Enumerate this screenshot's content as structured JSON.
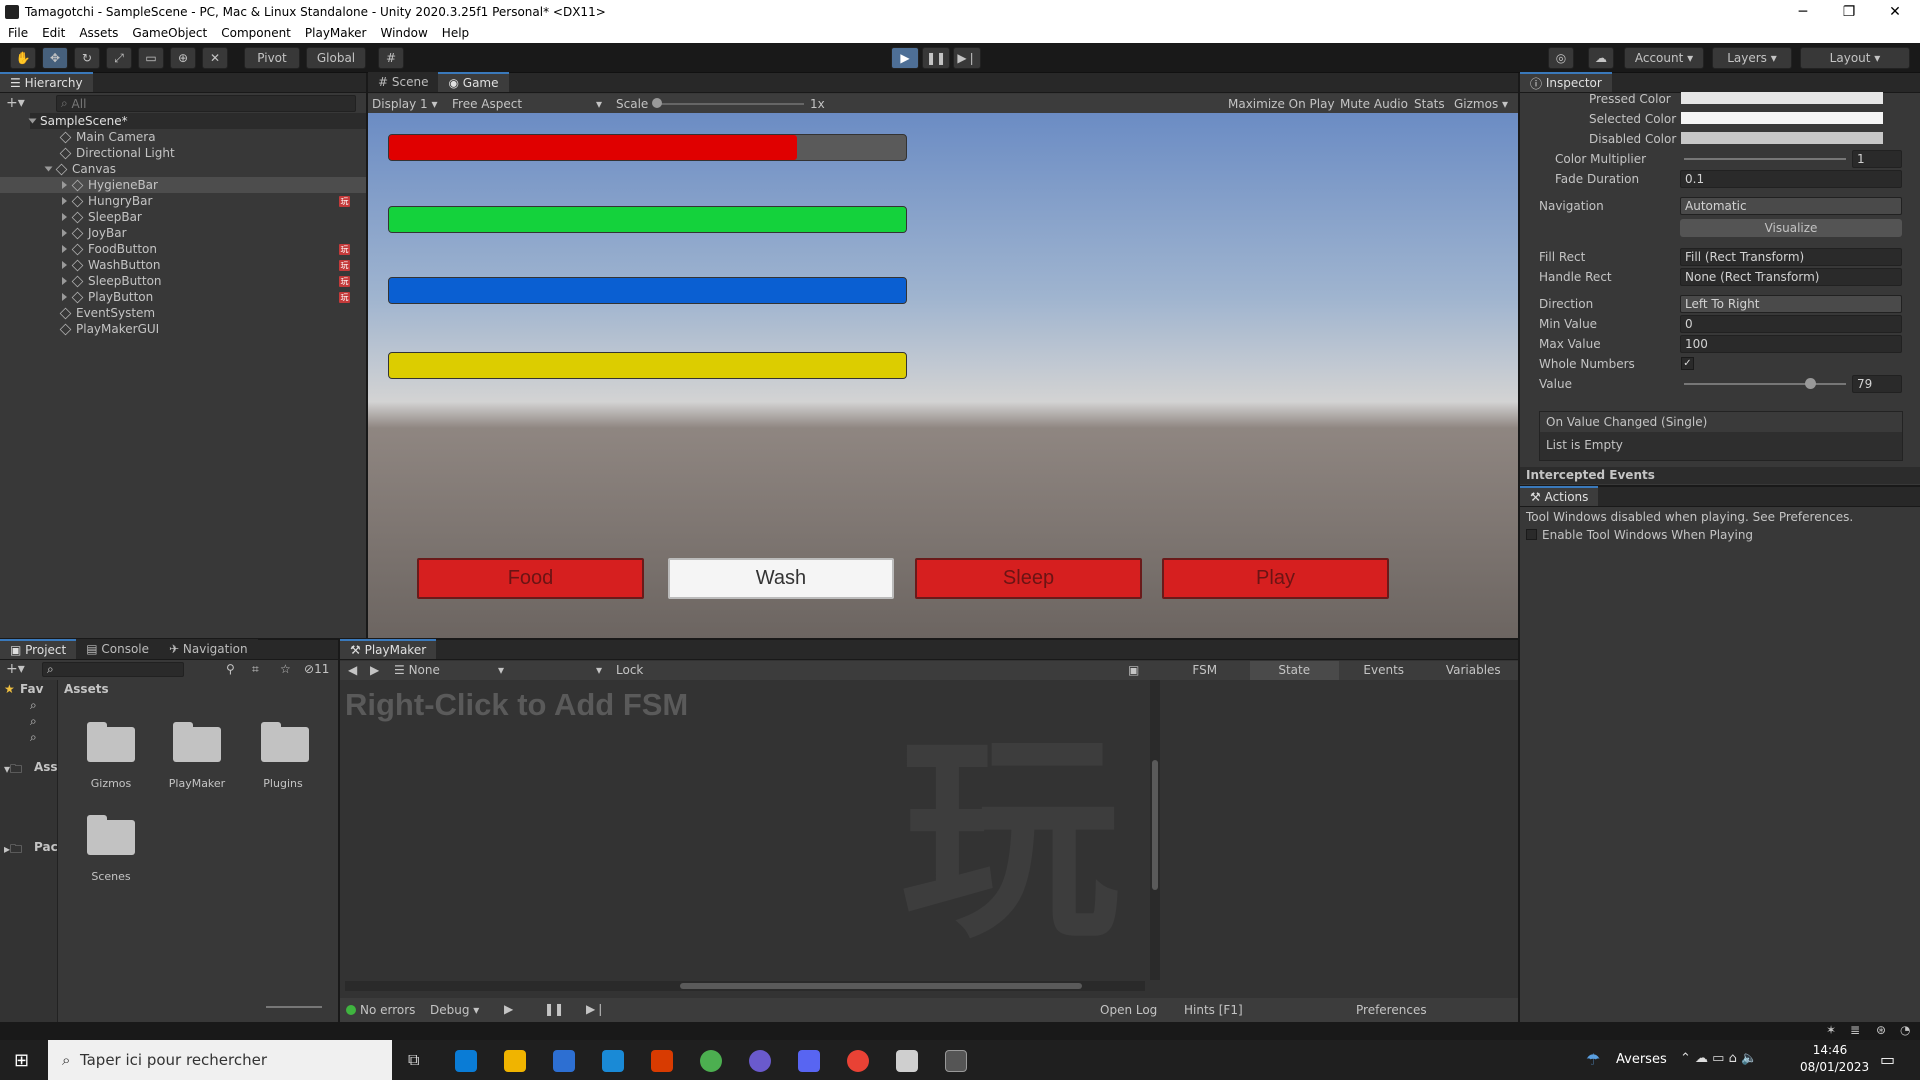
{
  "window": {
    "title": "Tamagotchi - SampleScene - PC, Mac & Linux Standalone - Unity 2020.3.25f1 Personal* <DX11>",
    "minimize": "─",
    "restore": "❐",
    "close": "✕"
  },
  "menu": [
    "File",
    "Edit",
    "Assets",
    "GameObject",
    "Component",
    "PlayMaker",
    "Window",
    "Help"
  ],
  "toolbar": {
    "pivot": "Pivot",
    "global": "Global",
    "account": "Account",
    "layers": "Layers",
    "layout": "Layout"
  },
  "hierarchy": {
    "tab": "Hierarchy",
    "search_placeholder": "All",
    "scene": "SampleScene*",
    "items": [
      {
        "name": "Main Camera"
      },
      {
        "name": "Directional Light"
      },
      {
        "name": "Canvas"
      },
      {
        "name": "HygieneBar"
      },
      {
        "name": "HungryBar"
      },
      {
        "name": "SleepBar"
      },
      {
        "name": "JoyBar"
      },
      {
        "name": "FoodButton"
      },
      {
        "name": "WashButton"
      },
      {
        "name": "SleepButton"
      },
      {
        "name": "PlayButton"
      },
      {
        "name": "EventSystem"
      },
      {
        "name": "PlayMakerGUI"
      }
    ]
  },
  "game": {
    "tab_scene": "Scene",
    "tab_game": "Game",
    "display": "Display 1",
    "aspect": "Free Aspect",
    "scale_label": "Scale",
    "scale_value": "1x",
    "maximize": "Maximize On Play",
    "mute": "Mute Audio",
    "stats": "Stats",
    "gizmos": "Gizmos",
    "bars": [
      {
        "color": "#e00000",
        "fill": 0.79
      },
      {
        "color": "#14d23c",
        "fill": 1.0
      },
      {
        "color": "#0a5fd2",
        "fill": 1.0
      },
      {
        "color": "#dccd00",
        "fill": 1.0
      }
    ],
    "buttons": [
      "Food",
      "Wash",
      "Sleep",
      "Play"
    ]
  },
  "inspector": {
    "tab": "Inspector",
    "pressed_color": "Pressed Color",
    "selected_color": "Selected Color",
    "disabled_color": "Disabled Color",
    "color_multiplier": "Color Multiplier",
    "color_multiplier_value": "1",
    "fade_duration": "Fade Duration",
    "fade_duration_value": "0.1",
    "navigation": "Navigation",
    "navigation_value": "Automatic",
    "visualize": "Visualize",
    "fill_rect": "Fill Rect",
    "fill_rect_value": "Fill (Rect Transform)",
    "handle_rect": "Handle Rect",
    "handle_rect_value": "None (Rect Transform)",
    "direction": "Direction",
    "direction_value": "Left To Right",
    "min_value": "Min Value",
    "min_value_value": "0",
    "max_value": "Max Value",
    "max_value_value": "100",
    "whole_numbers": "Whole Numbers",
    "value": "Value",
    "value_value": "79",
    "on_value_changed": "On Value Changed (Single)",
    "list_empty": "List is Empty",
    "intercepted": "Intercepted Events"
  },
  "actions": {
    "tab": "Actions",
    "message": "Tool Windows disabled when playing. See Preferences.",
    "enable_label": "Enable Tool Windows When Playing"
  },
  "project": {
    "tab_project": "Project",
    "tab_console": "Console",
    "tab_navigation": "Navigation",
    "count": "11",
    "favorites": "Fav",
    "assets_tree": "Ass",
    "packages": "Pac",
    "breadcrumb": "Assets",
    "folders": [
      "Gizmos",
      "PlayMaker",
      "Plugins",
      "Scenes"
    ]
  },
  "playmaker": {
    "tab": "PlayMaker",
    "fsm_select": "None",
    "lock": "Lock",
    "tabs": [
      "FSM",
      "State",
      "Events",
      "Variables"
    ],
    "hint": "Right-Click to Add FSM",
    "watermark": "玩",
    "status": "No errors",
    "debug": "Debug",
    "open_log": "Open Log",
    "hints": "Hints [F1]",
    "preferences": "Preferences"
  },
  "taskbar": {
    "search_placeholder": "Taper ici pour rechercher",
    "weather": "Averses",
    "time": "14:46",
    "date": "08/01/2023"
  }
}
